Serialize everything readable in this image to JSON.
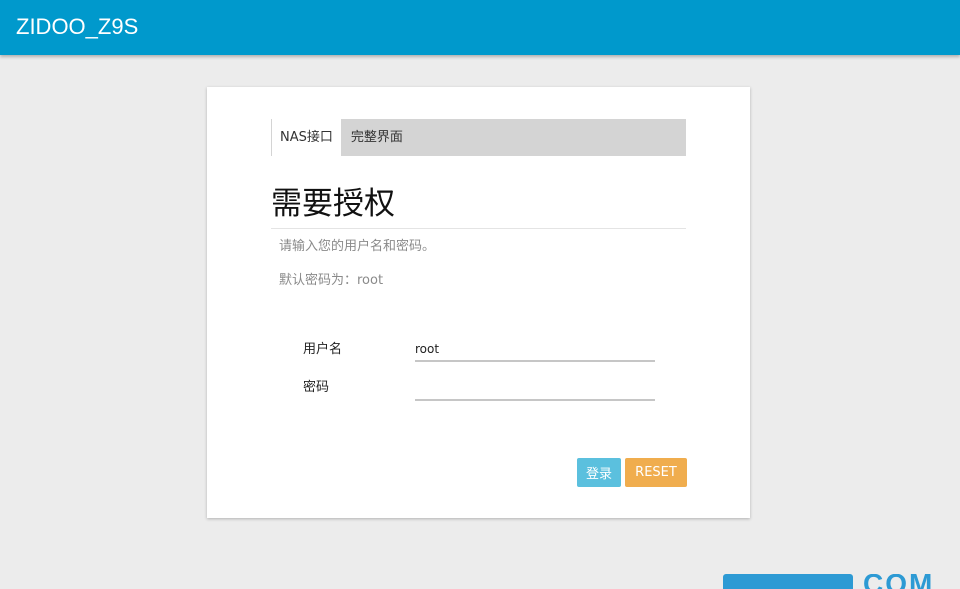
{
  "header": {
    "title": "ZIDOO_Z9S"
  },
  "tabs": [
    {
      "label": "NAS接口",
      "active": true
    },
    {
      "label": "完整界面",
      "active": false
    }
  ],
  "auth": {
    "title": "需要授权",
    "hint_line1": "请输入您的用户名和密码。",
    "hint_line2": "默认密码为：root"
  },
  "form": {
    "username_label": "用户名",
    "username_value": "root",
    "password_label": "密码",
    "password_value": ""
  },
  "buttons": {
    "login": "登录",
    "reset": "RESET"
  },
  "colors": {
    "header_bg": "#0099cc",
    "login_button": "#5bc0de",
    "reset_button": "#f0ad4e",
    "watermark": "#2d9ad4"
  }
}
